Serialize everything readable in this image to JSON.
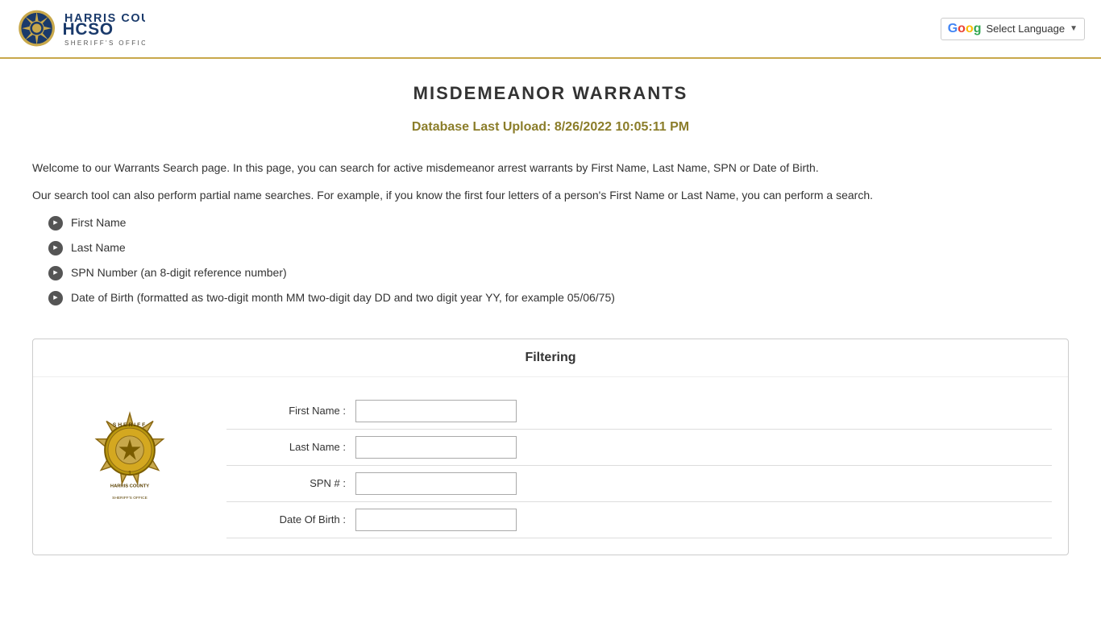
{
  "header": {
    "logo_alt": "Harris County Sheriff's Office",
    "translate_button_label": "Select Language"
  },
  "page": {
    "title": "MISDEMEANOR  WARRANTS",
    "db_upload_label": "Database Last Upload: 8/26/2022 10:05:11 PM",
    "description_1": "Welcome to our Warrants Search page. In this page, you can search for active misdemeanor arrest warrants by First Name, Last Name, SPN or Date of Birth.",
    "description_2": "Our search tool can also perform partial name searches. For example, if you know the first four letters of a person's First Name or Last Name, you can perform a search.",
    "bullet_items": [
      "First Name",
      "Last Name",
      "SPN Number (an 8-digit reference number)",
      "Date of Birth (formatted as two-digit month MM two-digit day DD and two digit year YY, for example 05/06/75)"
    ]
  },
  "filtering": {
    "header": "Filtering",
    "fields": [
      {
        "label": "First Name :",
        "name": "first-name-input",
        "value": ""
      },
      {
        "label": "Last Name :",
        "name": "last-name-input",
        "value": ""
      },
      {
        "label": "SPN # :",
        "name": "spn-input",
        "value": ""
      },
      {
        "label": "Date Of Birth :",
        "name": "dob-input",
        "value": ""
      }
    ]
  },
  "colors": {
    "gold": "#c8a84b",
    "dark_gold": "#8B7D2A",
    "text": "#333333"
  }
}
